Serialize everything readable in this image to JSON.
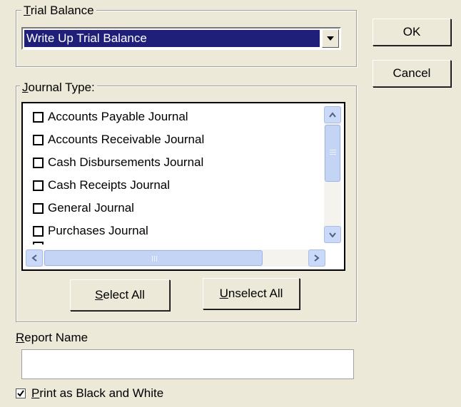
{
  "trial_balance": {
    "group_label_ul": "T",
    "group_label_rest": "rial Balance",
    "selected_value": "Write Up Trial Balance"
  },
  "buttons": {
    "ok": "OK",
    "cancel": "Cancel",
    "select_all_ul": "S",
    "select_all_rest": "elect All",
    "unselect_all_ul": "U",
    "unselect_all_rest": "nselect All"
  },
  "journal_type": {
    "group_label_ul": "J",
    "group_label_rest": "ournal Type:",
    "items": [
      {
        "label": "Accounts Payable Journal",
        "checked": false
      },
      {
        "label": "Accounts Receivable Journal",
        "checked": false
      },
      {
        "label": "Cash Disbursements Journal",
        "checked": false
      },
      {
        "label": "Cash Receipts Journal",
        "checked": false
      },
      {
        "label": "General Journal",
        "checked": false
      },
      {
        "label": "Purchases Journal",
        "checked": false
      }
    ]
  },
  "report_name": {
    "label_ul": "R",
    "label_rest": "eport Name",
    "value": ""
  },
  "print_bw": {
    "label_ul": "P",
    "label_rest": "rint as Black and White",
    "checked": true
  }
}
